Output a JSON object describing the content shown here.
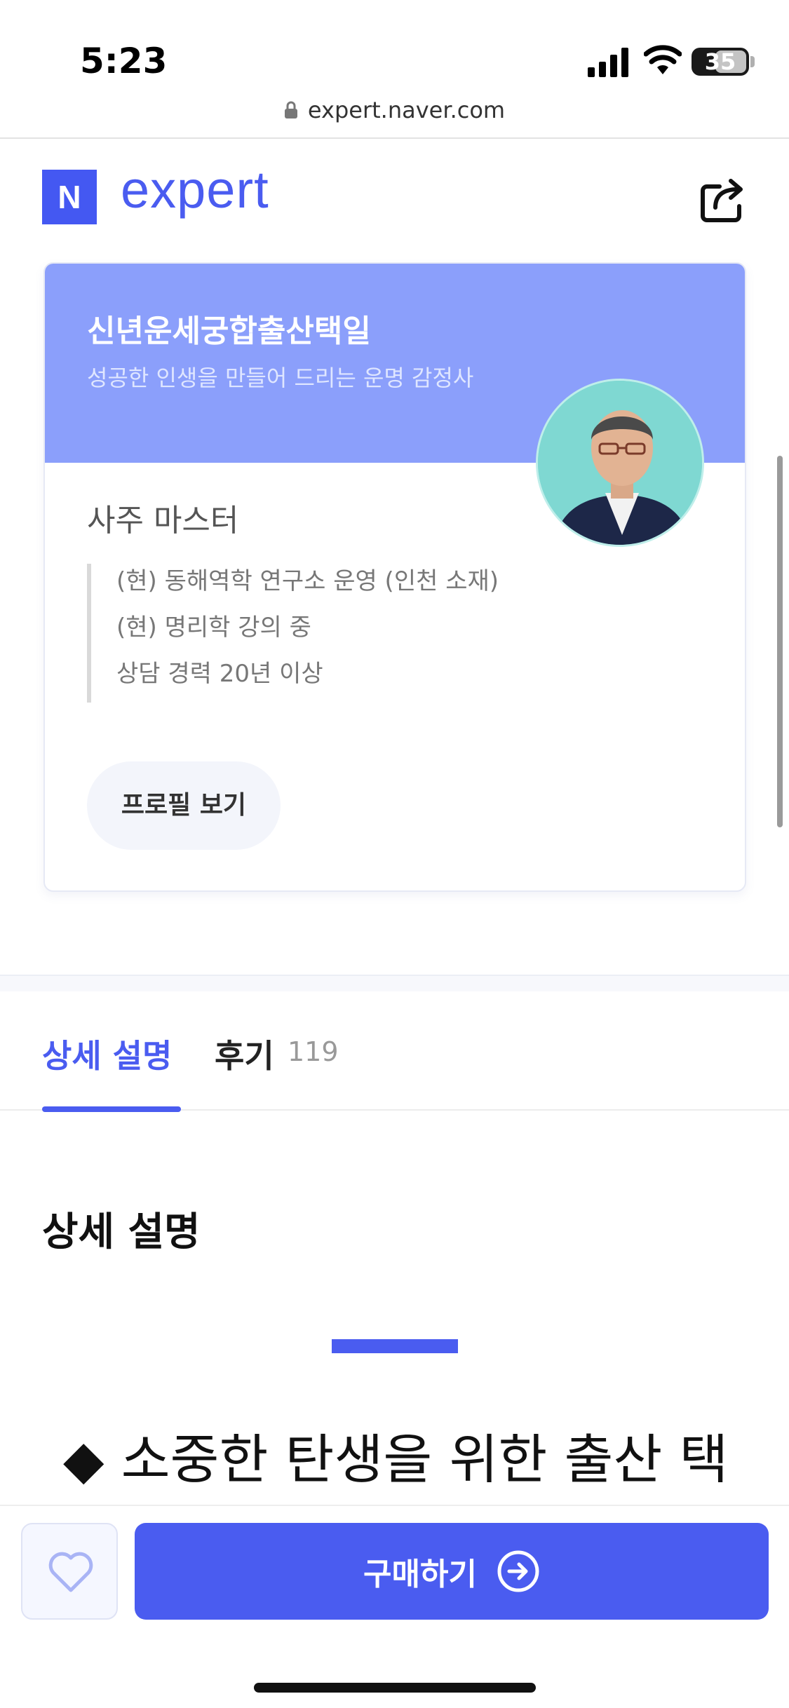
{
  "status_bar": {
    "time": "5:23",
    "battery": "35"
  },
  "browser": {
    "url": "expert.naver.com"
  },
  "header": {
    "logo_letter": "N",
    "logo_text": "expert"
  },
  "card": {
    "title": "신년운세궁합출산택일",
    "subtitle": "성공한 인생을 만들어 드리는 운명 감정사",
    "role": "사주 마스터",
    "career": [
      "(현) 동해역학 연구소 운영 (인천 소재)",
      "(현) 명리학 강의 중",
      "상담 경력 20년 이상"
    ],
    "profile_button": "프로필 보기"
  },
  "tabs": {
    "detail": "상세 설명",
    "review": "후기",
    "review_count": "119"
  },
  "content": {
    "section_title": "상세 설명",
    "intro_heading": "◆ 소중한 탄생을 위한 출산 택"
  },
  "bottom_bar": {
    "buy_label": "구매하기"
  },
  "colors": {
    "accent": "#4a5cf0",
    "card_top": "#8b9ffb"
  }
}
